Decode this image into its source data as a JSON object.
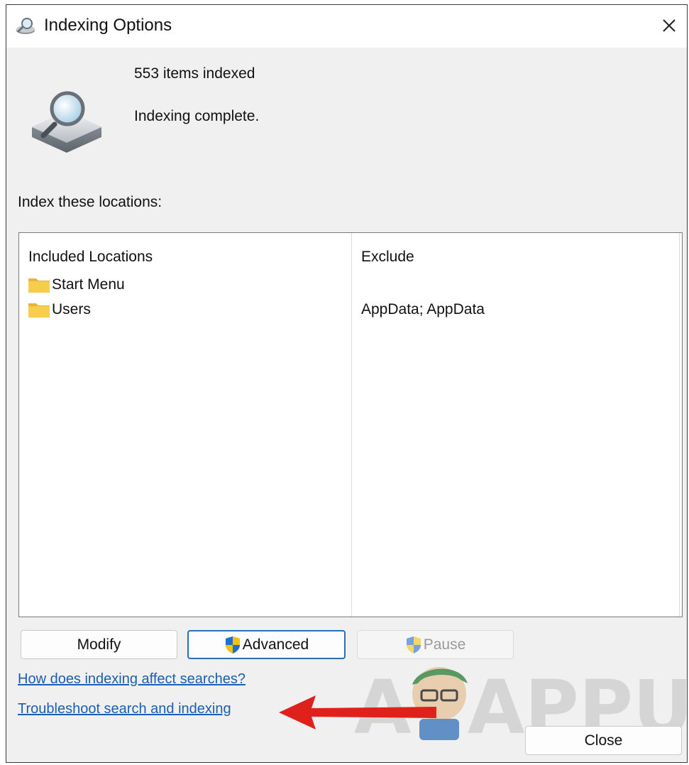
{
  "window": {
    "title": "Indexing Options",
    "icon": "indexing-options-icon",
    "close_icon": "close-icon"
  },
  "status": {
    "items_indexed": "553 items indexed",
    "state": "Indexing complete."
  },
  "locations": {
    "section_label": "Index these locations:",
    "columns": {
      "included": "Included Locations",
      "exclude": "Exclude"
    },
    "rows": [
      {
        "name": "Start Menu",
        "exclude": ""
      },
      {
        "name": "Users",
        "exclude": "AppData; AppData"
      }
    ]
  },
  "buttons": {
    "modify": "Modify",
    "advanced": "Advanced",
    "pause": "Pause",
    "close": "Close"
  },
  "links": {
    "how_indexing": "How does indexing affect searches?",
    "troubleshoot": "Troubleshoot search and indexing"
  },
  "watermark": {
    "text": "APPUALS"
  },
  "colors": {
    "link": "#1a5fb4",
    "accent_border": "#2a6fb0",
    "annotation_arrow": "#e0201b"
  }
}
